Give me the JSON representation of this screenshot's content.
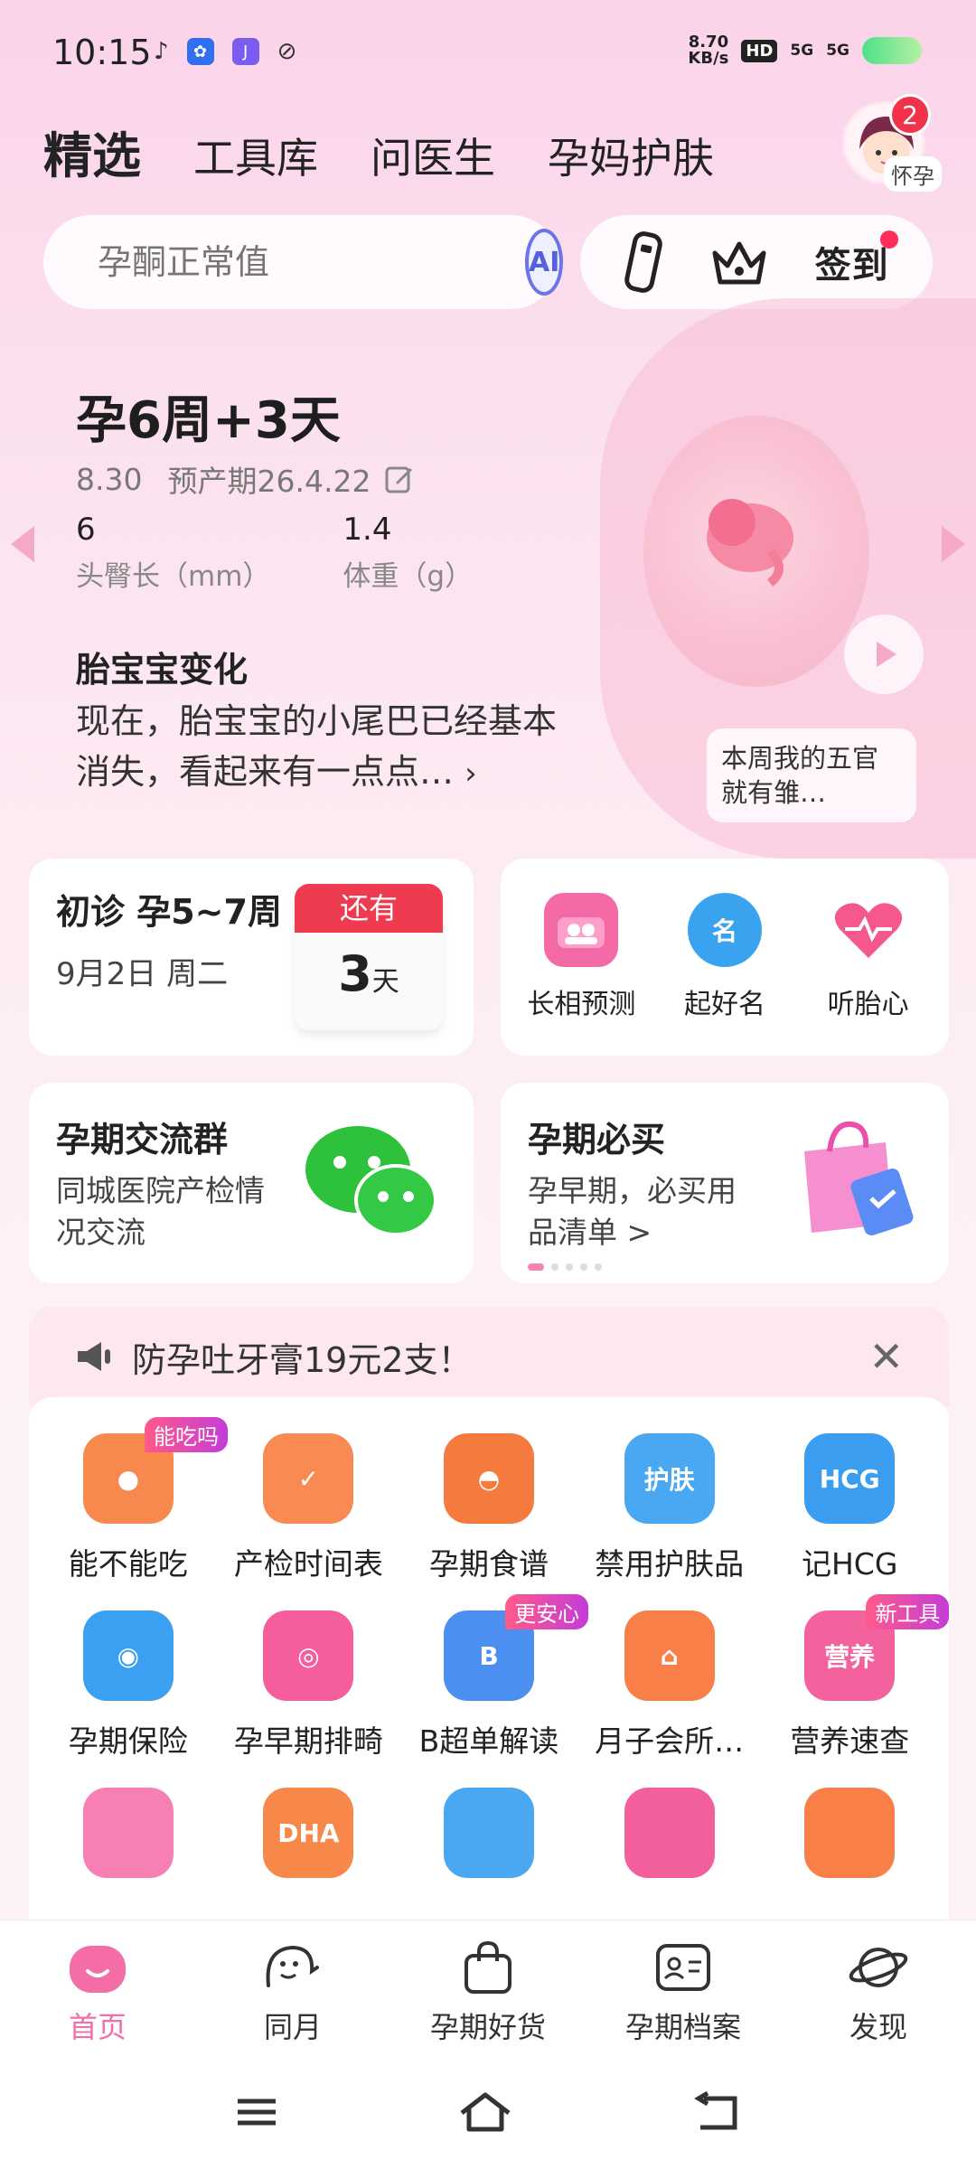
{
  "status_bar": {
    "time": "10:15",
    "net_speed_value": "8.70",
    "net_speed_unit": "KB/s",
    "hd": "HD",
    "signal1": "5G",
    "signal2": "5G"
  },
  "top_tabs": [
    "精选",
    "工具库",
    "问医生",
    "孕妈护肤"
  ],
  "avatar": {
    "label": "怀孕",
    "badge": "2"
  },
  "search": {
    "placeholder": "孕酮正常值",
    "ai_label": "AI"
  },
  "checkin_label": "签到",
  "hero": {
    "title": "孕6周+3天",
    "date": "8.30",
    "due_date": "预产期26.4.22",
    "stats": [
      {
        "value": "6",
        "label": "头臀长（mm）"
      },
      {
        "value": "1.4",
        "label": "体重（g）"
      }
    ],
    "change_title": "胎宝宝变化",
    "change_desc": "现在，胎宝宝的小尾巴已经基本消失，看起来有一点点…",
    "caption": "本周我的五官就有雏…"
  },
  "visit": {
    "title": "初诊 孕5~7周",
    "date": "9月2日 周二",
    "countdown_label": "还有",
    "countdown_value": "3",
    "countdown_unit": "天"
  },
  "quick_tools": [
    {
      "label": "长相预测",
      "icon": "face-predict-icon",
      "color": "#f36aa6"
    },
    {
      "label": "起好名",
      "icon": "name-icon",
      "color": "#3aa3f0"
    },
    {
      "label": "听胎心",
      "icon": "heartbeat-icon",
      "color": "#f5578f"
    }
  ],
  "group": {
    "title": "孕期交流群",
    "desc": "同城医院产检情况交流"
  },
  "buy": {
    "title": "孕期必买",
    "desc": "孕早期，必买用品清单 >"
  },
  "promo": {
    "text": "防孕吐牙膏19元2支！",
    "close": "✕"
  },
  "grid_items": [
    {
      "label": "能不能吃",
      "tag": "能吃吗",
      "color": "#f7894f",
      "glyph": "●"
    },
    {
      "label": "产检时间表",
      "tag": "",
      "color": "#f98a54",
      "glyph": "✓"
    },
    {
      "label": "孕期食谱",
      "tag": "",
      "color": "#f47a3e",
      "glyph": "◓"
    },
    {
      "label": "禁用护肤品",
      "tag": "",
      "color": "#4aa8f2",
      "glyph": "护肤"
    },
    {
      "label": "记HCG",
      "tag": "",
      "color": "#3a9df0",
      "glyph": "HCG"
    },
    {
      "label": "孕期保险",
      "tag": "",
      "color": "#3b9ff2",
      "glyph": "◉"
    },
    {
      "label": "孕早期排畸",
      "tag": "",
      "color": "#f55d9d",
      "glyph": "◎"
    },
    {
      "label": "B超单解读",
      "tag": "更安心",
      "color": "#4b8ff0",
      "glyph": "B"
    },
    {
      "label": "月子会所…",
      "tag": "",
      "color": "#f88048",
      "glyph": "⌂"
    },
    {
      "label": "营养速查",
      "tag": "新工具",
      "color": "#f4619f",
      "glyph": "营养"
    },
    {
      "label": "",
      "tag": "",
      "color": "#f77fb3",
      "glyph": ""
    },
    {
      "label": "",
      "tag": "",
      "color": "#f8874a",
      "glyph": "DHA"
    },
    {
      "label": "",
      "tag": "",
      "color": "#4aa8f2",
      "glyph": ""
    },
    {
      "label": "",
      "tag": "",
      "color": "#f35f9c",
      "glyph": ""
    },
    {
      "label": "",
      "tag": "",
      "color": "#f88048",
      "glyph": ""
    }
  ],
  "bottom_nav": [
    {
      "label": "首页",
      "icon": "home-icon",
      "active": true
    },
    {
      "label": "同月",
      "icon": "same-month-icon",
      "active": false
    },
    {
      "label": "孕期好货",
      "icon": "shopping-bag-icon",
      "active": false
    },
    {
      "label": "孕期档案",
      "icon": "profile-card-icon",
      "active": false
    },
    {
      "label": "发现",
      "icon": "planet-icon",
      "active": false
    }
  ],
  "colors": {
    "accent": "#f56da7",
    "badge_red": "#f1324a",
    "calendar_red": "#ef3b4f"
  }
}
